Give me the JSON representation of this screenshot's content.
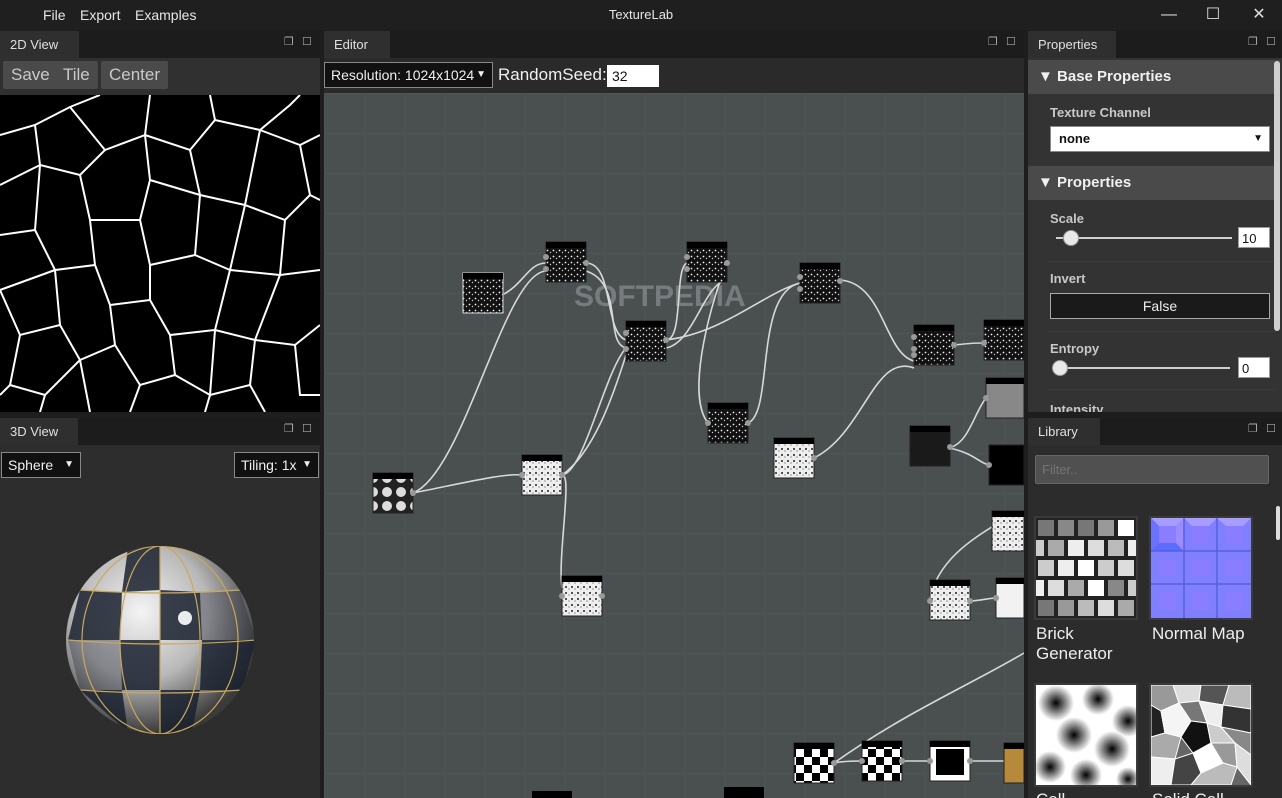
{
  "window": {
    "title": "TextureLab",
    "menu": [
      "File",
      "Export",
      "Examples"
    ],
    "controls": {
      "minimize": "—",
      "maximize": "☐",
      "close": "✕"
    }
  },
  "view2d": {
    "tab": "2D View",
    "buttons": {
      "save": "Save",
      "tile": "Tile",
      "center": "Center"
    }
  },
  "view3d": {
    "tab": "3D View",
    "shape_select": "Sphere",
    "tiling_select": "Tiling: 1x"
  },
  "editor": {
    "tab": "Editor",
    "resolution_select": "Resolution: 1024x1024",
    "seed_label": "RandomSeed:",
    "seed_value": "32",
    "watermark": "SOFTPEDIA"
  },
  "properties": {
    "tab": "Properties",
    "base_section": "▼ Base Properties",
    "texture_channel_label": "Texture Channel",
    "texture_channel_value": "none",
    "props_section": "▼ Properties",
    "scale_label": "Scale",
    "scale_value": "10",
    "scale_fraction": 0.05,
    "invert_label": "Invert",
    "invert_value": "False",
    "entropy_label": "Entropy",
    "entropy_value": "0",
    "entropy_fraction": 0.0,
    "intensity_label": "Intensity"
  },
  "library": {
    "tab": "Library",
    "filter_placeholder": "Filter..",
    "items": [
      {
        "label": "Brick Generator"
      },
      {
        "label": "Normal Map"
      },
      {
        "label": "Cell"
      },
      {
        "label": "Solid Cell"
      }
    ]
  },
  "colors": {
    "accent_bg": "#2a2a2a",
    "graph_bg": "#4a4f50",
    "header_bg": "#1c1c1c"
  }
}
